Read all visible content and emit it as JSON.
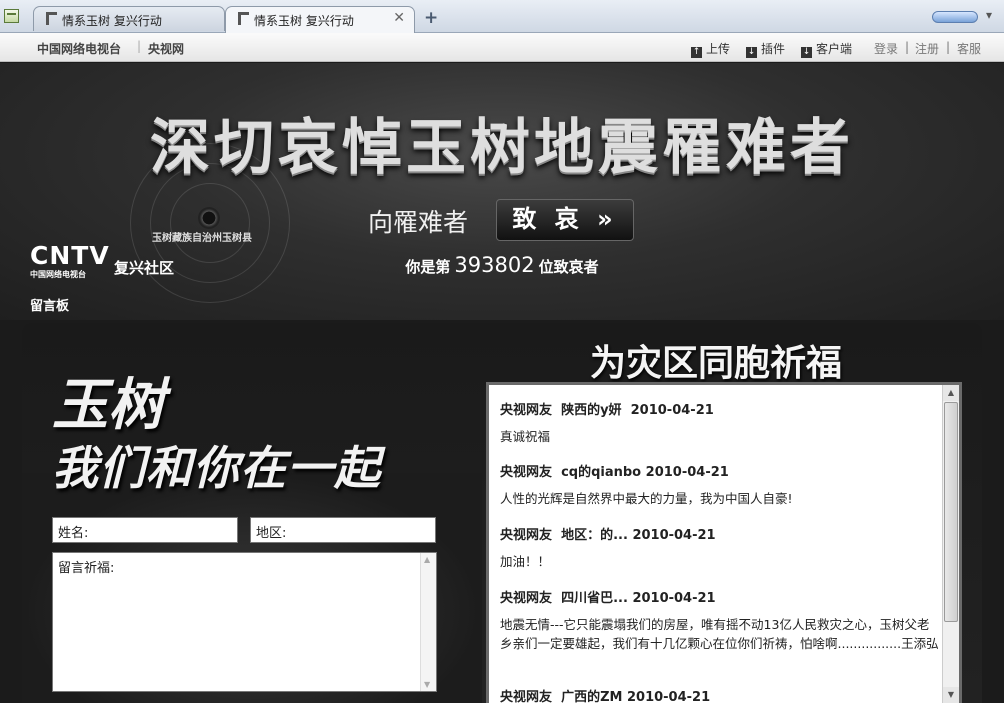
{
  "browser": {
    "tabs": [
      {
        "label": "情系玉树  复兴行动",
        "active": false
      },
      {
        "label": "情系玉树  复兴行动",
        "active": true
      }
    ],
    "new_tab_icon": "plus-icon",
    "close_icon": "close-icon"
  },
  "sitenav": {
    "left": [
      "中国网络电视台",
      "央视网"
    ],
    "tools": [
      {
        "label": "上传",
        "icon": "upload-icon"
      },
      {
        "label": "插件",
        "icon": "download-icon"
      },
      {
        "label": "客户端",
        "icon": "download-icon"
      }
    ],
    "links": [
      "登录",
      "注册",
      "客服"
    ],
    "separator": "|"
  },
  "hero": {
    "title": "深切哀悼玉树地震罹难者",
    "county_label": "玉树藏族自治州玉树县",
    "mourn_text": "向罹难者",
    "mourn_button": "致 哀 »",
    "counter_prefix": "你是第",
    "counter_value": "393802",
    "counter_suffix": "位致哀者",
    "logo_big": "CNTV",
    "logo_small": "中国网络电视台",
    "community": "复兴社区",
    "board_label": "留言板"
  },
  "form": {
    "slogan_line1": "玉树",
    "slogan_line2": "我们和你在一起",
    "name_placeholder": "姓名:",
    "region_placeholder": "地区:",
    "message_placeholder": "留言祈福:"
  },
  "messages": {
    "title": "为灾区同胞祈福",
    "items": [
      {
        "author": "央视网友",
        "name": "陕西的y妍",
        "date": "2010-04-21",
        "body": "真诚祝福"
      },
      {
        "author": "央视网友",
        "name": "cq的qianbo",
        "date": "2010-04-21",
        "body": "人性的光辉是自然界中最大的力量，我为中国人自豪!"
      },
      {
        "author": "央视网友",
        "name": "地区：的...",
        "date": "2010-04-21",
        "body": "加油！！"
      },
      {
        "author": "央视网友",
        "name": "四川省巴...",
        "date": "2010-04-21",
        "body": "地震无情---它只能震塌我们的房屋，唯有摇不动13亿人民救灾之心，玉树父老乡亲们一定要雄起，我们有十几亿颗心在位你们祈祷，怕啥啊................王添弘"
      },
      {
        "author": "央视网友",
        "name": "广西的ZM",
        "date": "2010-04-21",
        "body": ""
      }
    ]
  }
}
